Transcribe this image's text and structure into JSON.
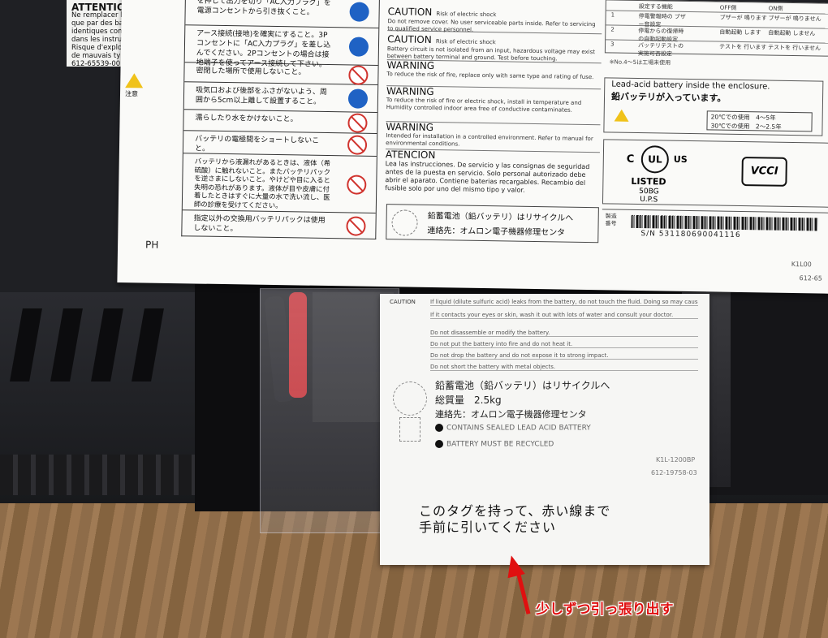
{
  "attention": {
    "heading": "ATTENTION",
    "body": "Ne remplacer les batteries que par des batteries identiques comme spécifié dans les instructions. Risque d'explosion en cas de mauvais type.",
    "code": "612-65539-00"
  },
  "jp_warnings": [
    "を押して出力を切り「AC入力プラグ」を電源コンセントから引き抜くこと。",
    "アース接続(接地)を確実にすること。3Pコンセントに「AC入力プラグ」を差し込んでください。2Pコンセントの場合は接地端子を使ってアース接続して下さい。",
    "密閉した場所で使用しないこと。",
    "吸気口および後部をふさがないよう、周囲から5cm以上離して設置すること。",
    "濡らしたり水をかけないこと。",
    "バッテリの電極間をショートしないこと。",
    "バッテリから液漏れがあるときは、液体（希硫酸）に触れないこと。またバッテリパックを逆さまにしないこと。やけどや目に入ると失明の恐れがあります。液体が目や皮膚に付着したときはすぐに大量の水で洗い流し、医師の診療を受けてください。",
    "指定以外の交換用バッテリパックは使用しないこと。"
  ],
  "caution_word": "注意",
  "ph_mark": "PH",
  "en_warnings": [
    {
      "heading": "CAUTION",
      "sub": "Risk of electric shock",
      "text": "Do not remove cover. No user serviceable parts inside. Refer to servicing to qualified service personnel."
    },
    {
      "heading": "CAUTION",
      "sub": "Risk of electric shock",
      "text": "Battery circuit is not isolated from an input, hazardous voltage may exist between battery terminal and ground. Test before touching."
    },
    {
      "heading": "WARNING",
      "sub": "",
      "text": "To reduce the risk of fire, replace only with same type and rating of fuse."
    },
    {
      "heading": "WARNING",
      "sub": "",
      "text": "To reduce the risk of fire or electric shock, install in temperature and Humidity controlled indoor area free of conductive contaminates."
    },
    {
      "heading": "WARNING",
      "sub": "",
      "text": "Intended for installation in a controlled environment. Refer to manual for environmental conditions."
    },
    {
      "heading": "ATENCION",
      "sub": "",
      "text": "Lea las instrucciones. De servicio y las consignas de seguridad antes de la puesta en servicio. Solo personal autorizado debe abrir el aparato. Contiene baterias recargables. Recambio del fusible solo por uno del mismo tipo y valor."
    }
  ],
  "recycle_label": {
    "line1": "鉛蓄電池（鉛バッテリ）はリサイクルへ",
    "line2": "連絡先：オムロン電子機器修理センタ"
  },
  "settings_table": {
    "rows": [
      [
        "",
        "設定する機能",
        "OFF側",
        "ON側"
      ],
      [
        "1",
        "停電警報時の ブザー音設定",
        "ブザーが 鳴ります",
        "ブザーが 鳴りません"
      ],
      [
        "2",
        "停電からの復帰時 の自動起動設定",
        "自動起動 します",
        "自動起動 しません"
      ],
      [
        "3",
        "バッテリテストの 実施可否設定",
        "テストを 行います",
        "テストを 行いません"
      ]
    ],
    "note": "※No.4～5は工場未使用"
  },
  "lead_acid": {
    "english": "Lead-acid battery inside the enclosure.",
    "japanese": "鉛バッテリが入っています。",
    "life_line1": "20℃での使用　4～5年",
    "life_line2": "30℃での使用　2～2.5年"
  },
  "certification": {
    "ul_c": "C",
    "ul_mark": "UL",
    "ul_us": "US",
    "listed": "LISTED",
    "model_line1": "50BG",
    "model_line2": "U.P.S",
    "vcci": "VCCI"
  },
  "serial": {
    "label_line1": "製造",
    "label_line2": "番号",
    "number": "S/N 531180690041116"
  },
  "label_codes": {
    "code1": "K1L00",
    "code2": "612-65"
  },
  "battery_tag": {
    "caution": "CAUTION",
    "en_lines": [
      "If liquid (dilute sulfuric acid) leaks from the battery, do not touch the fluid. Doing so may cause blindness or burns.",
      "If it contacts your eyes or skin, wash it out with lots of water and consult your doctor.",
      "Do not disassemble or modify the battery.",
      "Do not put the battery into fire and do not heat it.",
      "Do not drop the battery and do not expose it to strong impact.",
      "Do not short the battery with metal objects."
    ],
    "jp_line1": "鉛蓄電池（鉛バッテリ）はリサイクルへ",
    "jp_line2": "総質量　2.5kg",
    "jp_line3": "連絡先：オムロン電子機器修理センタ",
    "bullet1": "CONTAINS SEALED LEAD ACID BATTERY",
    "bullet2": "BATTERY MUST BE RECYCLED",
    "code1": "K1L-1200BP",
    "code2": "612-19758-03",
    "instruction_line1": "このタグを持って、赤い線まで",
    "instruction_line2": "手前に引いてください"
  },
  "annotation": {
    "caption": "少しずつ引っ張り出す",
    "color": "#e01010"
  }
}
